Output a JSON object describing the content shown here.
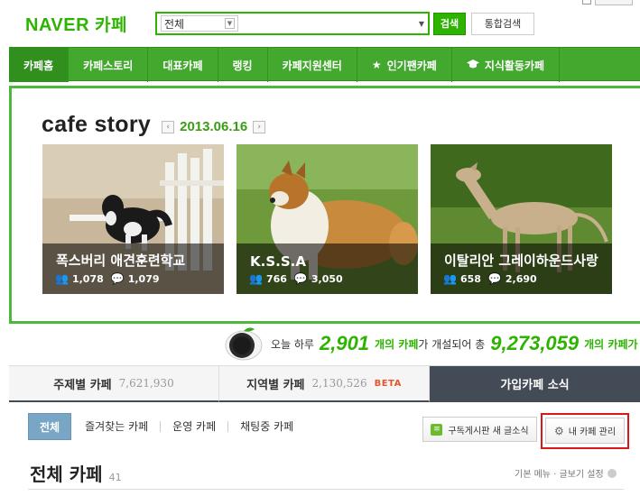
{
  "header": {
    "logo_naver": "NAVER",
    "logo_cafe": "카페",
    "search_scope": "전체",
    "search_button": "검색",
    "total_search_button": "통합검색"
  },
  "nav": {
    "items": [
      {
        "label": "카페홈",
        "active": true
      },
      {
        "label": "카페스토리"
      },
      {
        "label": "대표카페"
      },
      {
        "label": "랭킹"
      },
      {
        "label": "카페지원센터"
      },
      {
        "label": "인기팬카페",
        "icon": "star-icon"
      },
      {
        "label": "지식활동카페",
        "icon": "graduation-cap-icon"
      }
    ]
  },
  "story": {
    "title": "cafe story",
    "date": "2013.06.16",
    "cards": [
      {
        "name": "폭스버리 애견훈련학교",
        "members": "1,078",
        "comments": "1,079"
      },
      {
        "name": "K.S.S.A",
        "members": "766",
        "comments": "3,050"
      },
      {
        "name": "이탈리안 그레이하운드사랑",
        "members": "658",
        "comments": "2,690"
      }
    ]
  },
  "counter": {
    "prefix": "오늘 하루",
    "today_count": "2,901",
    "mid_text": "개의 카페",
    "mid_suffix": "가 개설되어 총",
    "total_count": "9,273,059",
    "end_text": "개의 카페가"
  },
  "tabs": [
    {
      "label": "주제별 카페",
      "count": "7,621,930"
    },
    {
      "label": "지역별 카페",
      "count": "2,130,526",
      "badge": "BETA"
    },
    {
      "label": "가입카페 소식",
      "active": true
    }
  ],
  "filter": {
    "all": "전체",
    "links": [
      "즐겨찾는 카페",
      "운영 카페",
      "채팅중 카페"
    ],
    "rss_button": "구독게시판 새 글소식",
    "manage_button": "내 카페 관리"
  },
  "section": {
    "title": "전체 카페",
    "count": "41",
    "options": "기본 메뉴 · 글보기 설정"
  },
  "colors": {
    "brand_green": "#2db400",
    "nav_green": "#43a92e",
    "tab_dark": "#434b56",
    "highlight_red": "#d7191c"
  }
}
